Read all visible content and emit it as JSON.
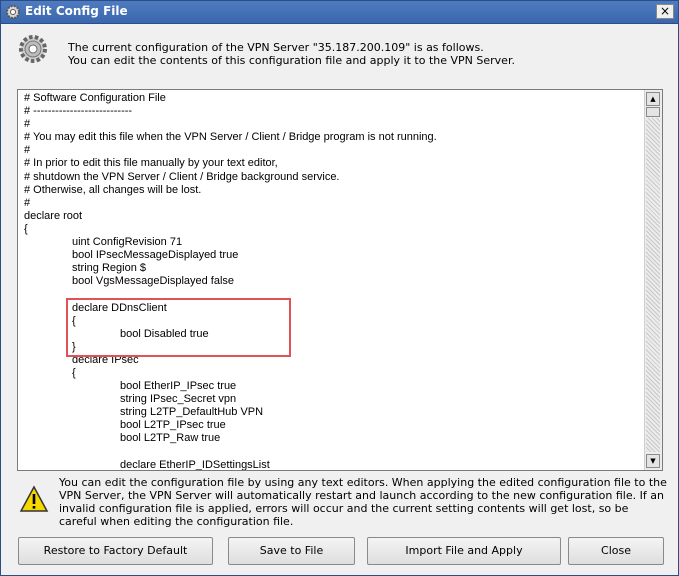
{
  "window": {
    "title": "Edit Config File",
    "close_glyph": "×"
  },
  "header": {
    "line1": "The current configuration of the VPN Server \"35.187.200.109\" is as follows.",
    "line2": "You can edit the contents of this configuration file and apply it to the VPN Server."
  },
  "editor": {
    "lines": [
      "# Software Configuration File",
      "# ---------------------------",
      "#",
      "# You may edit this file when the VPN Server / Client / Bridge program is not running.",
      "#",
      "# In prior to edit this file manually by your text editor,",
      "# shutdown the VPN Server / Client / Bridge background service.",
      "# Otherwise, all changes will be lost.",
      "#",
      "declare root",
      "{",
      "\t\tuint ConfigRevision 71",
      "\t\tbool IPsecMessageDisplayed true",
      "\t\tstring Region $",
      "\t\tbool VgsMessageDisplayed false",
      "",
      "\t\tdeclare DDnsClient",
      "\t\t{",
      "\t\t\t\tbool Disabled true",
      "\t\t}",
      "\t\tdeclare IPsec",
      "\t\t{",
      "\t\t\t\tbool EtherIP_IPsec true",
      "\t\t\t\tstring IPsec_Secret vpn",
      "\t\t\t\tstring L2TP_DefaultHub VPN",
      "\t\t\t\tbool L2TP_IPsec true",
      "\t\t\t\tbool L2TP_Raw true",
      "",
      "\t\t\t\tdeclare EtherIP_IDSettingsList"
    ]
  },
  "warning": {
    "text": "You can edit the configuration file by using any text editors. When applying the edited configuration file to the VPN Server, the VPN Server will automatically restart and launch according to the new configuration file. If an invalid configuration file is applied, errors will occur and the current setting contents will get lost, so be careful when editing the configuration file."
  },
  "buttons": {
    "restore": "Restore to Factory Default",
    "save": "Save to File",
    "import": "Import File and Apply",
    "close": "Close"
  },
  "icons": {
    "title": "gear-icon",
    "header": "gear-icon",
    "warning": "warning-icon"
  }
}
